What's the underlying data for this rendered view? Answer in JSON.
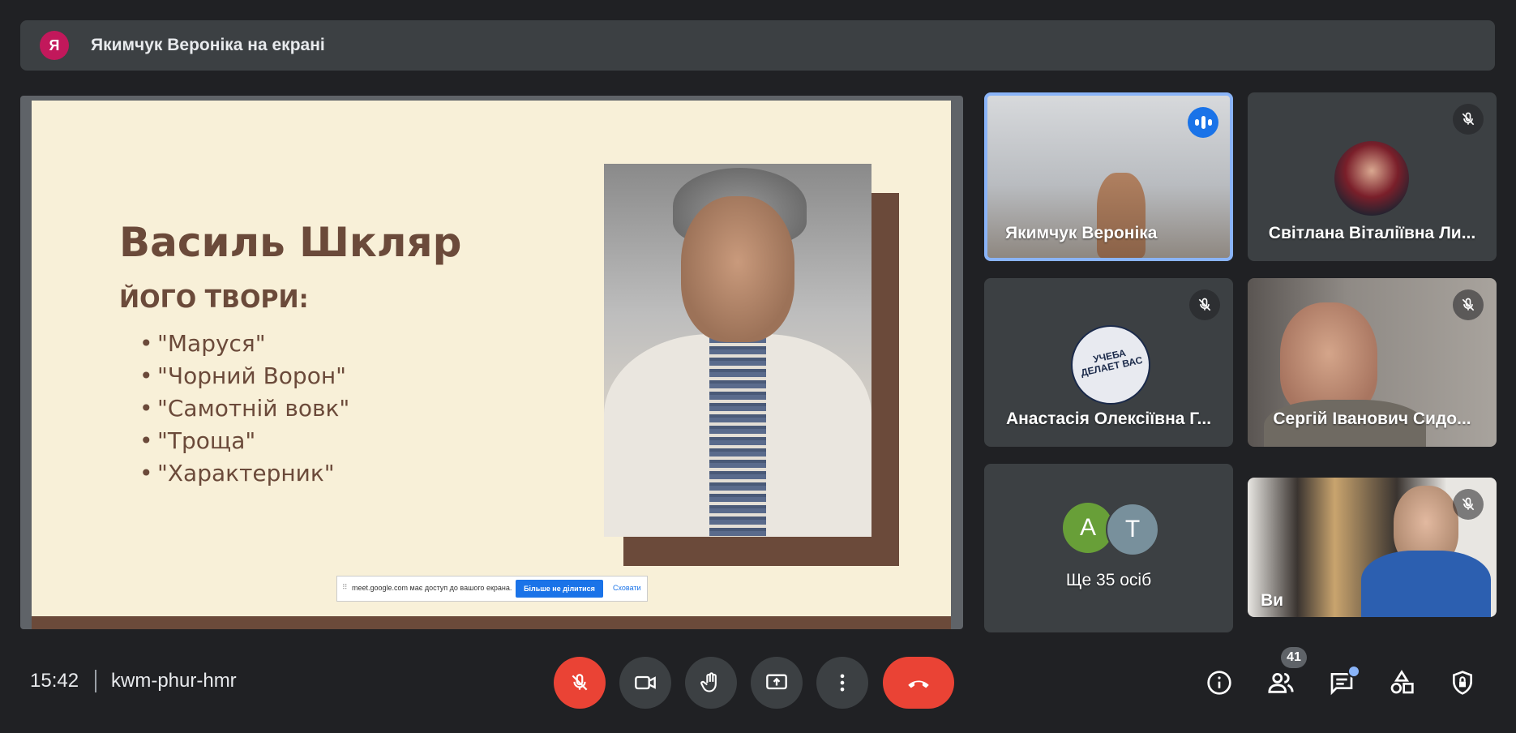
{
  "banner": {
    "avatar_letter": "Я",
    "text": "Якимчук Вероніка на екрані"
  },
  "slide": {
    "title": "Василь Шкляр",
    "subtitle": "ЙОГО ТВОРИ:",
    "works": [
      "\"Маруся\"",
      "\"Чорний Ворон\"",
      "\"Самотній вовк\"",
      "\"Троща\"",
      "\"Характерник\""
    ]
  },
  "share_bar": {
    "message": "meet.google.com має доступ до вашого екрана.",
    "stop_label": "Більше не ділитися",
    "hide_label": "Сховати"
  },
  "participants": [
    {
      "name": "Якимчук Вероніка",
      "state": "speaking"
    },
    {
      "name": "Світлана Віталіївна Ли...",
      "state": "muted"
    },
    {
      "name": "Анастасія Олексіївна Г...",
      "state": "muted",
      "avatar_text": "УЧЕБА ДЕЛАЕТ ВАС"
    },
    {
      "name": "Сергій Іванович Сидо...",
      "state": "muted"
    },
    {
      "name": "Ще 35 осіб",
      "avatars": [
        "A",
        "T"
      ]
    },
    {
      "name": "Ви",
      "state": "muted"
    }
  ],
  "bottom": {
    "time": "15:42",
    "meeting_code": "kwm-phur-hmr",
    "people_count": "41"
  },
  "colors": {
    "accent": "#1a73e8",
    "danger": "#ea4335",
    "tile_bg": "#3c4043"
  }
}
